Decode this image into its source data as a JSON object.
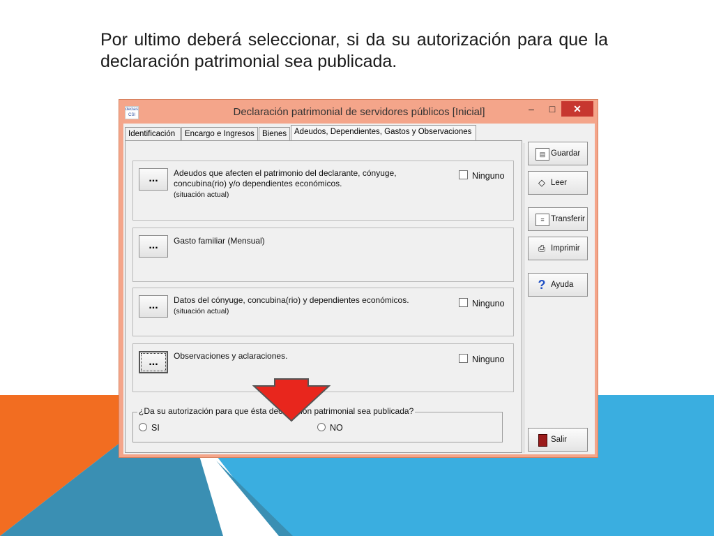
{
  "slide": {
    "text": "Por ultimo deberá seleccionar, si da su autorización para que la declaración patrimonial sea publicada."
  },
  "window": {
    "title": "Declaración patrimonial de servidores públicos [Inicial]",
    "icon_label": "declara CSI",
    "controls": {
      "minimize": "–",
      "maximize": "□",
      "close": "✕"
    }
  },
  "tabs": [
    {
      "label": "Identificación"
    },
    {
      "label": "Encargo e Ingresos"
    },
    {
      "label": "Bienes"
    },
    {
      "label": "Adeudos, Dependientes, Gastos y Observaciones"
    }
  ],
  "sections": [
    {
      "button": "...",
      "text": "Adeudos que afecten el patrimonio del declarante, cónyuge, concubina(rio) y/o dependientes económicos.",
      "sub": "(situación actual)",
      "checkbox": "Ninguno"
    },
    {
      "button": "...",
      "text": "Gasto familiar (Mensual)"
    },
    {
      "button": "...",
      "text": "Datos del cónyuge, concubina(rio) y dependientes económicos.",
      "sub": "(situación actual)",
      "checkbox": "Ninguno"
    },
    {
      "button": "...",
      "text": "Observaciones y aclaraciones.",
      "checkbox": "Ninguno"
    }
  ],
  "authorization": {
    "question": "¿Da su autorización para que ésta declaración patrimonial sea publicada?",
    "yes": "SI",
    "no": "NO"
  },
  "side_buttons": {
    "save": "Guardar",
    "read": "Leer",
    "transfer": "Transferir",
    "print": "Imprimir",
    "help": "Ayuda",
    "exit": "Salir"
  },
  "colors": {
    "titlebar": "#f4a58a",
    "close": "#c7372f",
    "arrow": "#e8261d",
    "bg_orange": "#f26d21",
    "bg_blue": "#3aaee0"
  }
}
